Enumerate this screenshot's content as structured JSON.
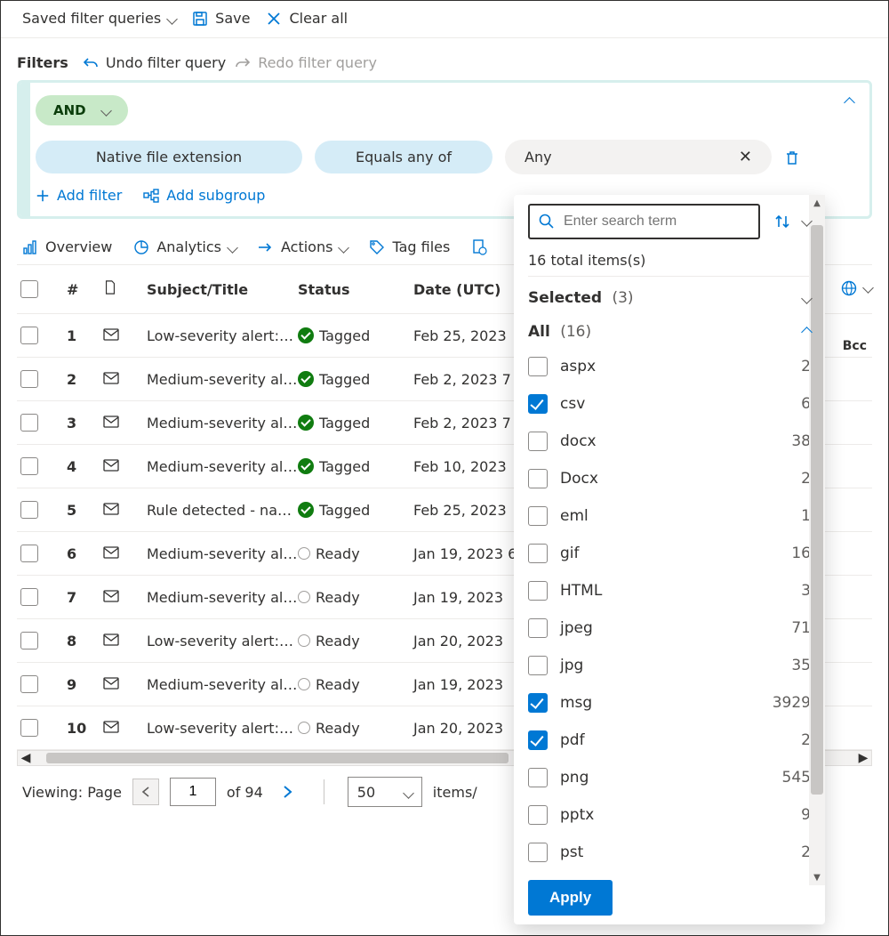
{
  "toolbar1": {
    "saved_queries": "Saved filter queries",
    "save": "Save",
    "clear": "Clear all"
  },
  "toolbar2": {
    "filters_label": "Filters",
    "undo": "Undo filter query",
    "redo": "Redo filter query"
  },
  "filter": {
    "logic": "AND",
    "field_label": "Native file extension",
    "operator_label": "Equals any of",
    "value_label": "Any",
    "add_filter": "Add filter",
    "add_subgroup": "Add subgroup"
  },
  "actionbar": {
    "overview": "Overview",
    "analytics": "Analytics",
    "actions": "Actions",
    "tag_files": "Tag files"
  },
  "columns": {
    "num": "#",
    "subject": "Subject/Title",
    "status": "Status",
    "date": "Date (UTC)",
    "bcc": "Bcc"
  },
  "status_labels": {
    "tagged": "Tagged",
    "ready": "Ready"
  },
  "rows": [
    {
      "n": "1",
      "subject": "Low-severity alert: …",
      "status": "tagged",
      "date": "Feb 25, 2023"
    },
    {
      "n": "2",
      "subject": "Medium-severity al…",
      "status": "tagged",
      "date": "Feb 2, 2023 7"
    },
    {
      "n": "3",
      "subject": "Medium-severity al…",
      "status": "tagged",
      "date": "Feb 2, 2023 7"
    },
    {
      "n": "4",
      "subject": "Medium-severity al…",
      "status": "tagged",
      "date": "Feb 10, 2023"
    },
    {
      "n": "5",
      "subject": "Rule detected - na…",
      "status": "tagged",
      "date": "Feb 25, 2023"
    },
    {
      "n": "6",
      "subject": "Medium-severity al…",
      "status": "ready",
      "date": "Jan 19, 2023 6"
    },
    {
      "n": "7",
      "subject": "Medium-severity al…",
      "status": "ready",
      "date": "Jan 19, 2023"
    },
    {
      "n": "8",
      "subject": "Low-severity alert: …",
      "status": "ready",
      "date": "Jan 20, 2023"
    },
    {
      "n": "9",
      "subject": "Medium-severity al…",
      "status": "ready",
      "date": "Jan 19, 2023"
    },
    {
      "n": "10",
      "subject": "Low-severity alert: …",
      "status": "ready",
      "date": "Jan 20, 2023"
    }
  ],
  "pager": {
    "viewing": "Viewing: Page",
    "page": "1",
    "of_pages": "of 94",
    "per_page": "50",
    "items_suffix": "items/"
  },
  "popup": {
    "search_placeholder": "Enter search term",
    "total": "16 total items(s)",
    "selected_label": "Selected",
    "selected_count": "(3)",
    "all_label": "All",
    "all_count": "(16)",
    "apply": "Apply",
    "options": [
      {
        "label": "aspx",
        "count": "2",
        "sel": false
      },
      {
        "label": "csv",
        "count": "6",
        "sel": true
      },
      {
        "label": "docx",
        "count": "38",
        "sel": false
      },
      {
        "label": "Docx",
        "count": "2",
        "sel": false
      },
      {
        "label": "eml",
        "count": "1",
        "sel": false
      },
      {
        "label": "gif",
        "count": "16",
        "sel": false
      },
      {
        "label": "HTML",
        "count": "3",
        "sel": false
      },
      {
        "label": "jpeg",
        "count": "71",
        "sel": false
      },
      {
        "label": "jpg",
        "count": "35",
        "sel": false
      },
      {
        "label": "msg",
        "count": "3929",
        "sel": true
      },
      {
        "label": "pdf",
        "count": "2",
        "sel": true
      },
      {
        "label": "png",
        "count": "545",
        "sel": false
      },
      {
        "label": "pptx",
        "count": "9",
        "sel": false
      },
      {
        "label": "pst",
        "count": "2",
        "sel": false
      }
    ]
  }
}
